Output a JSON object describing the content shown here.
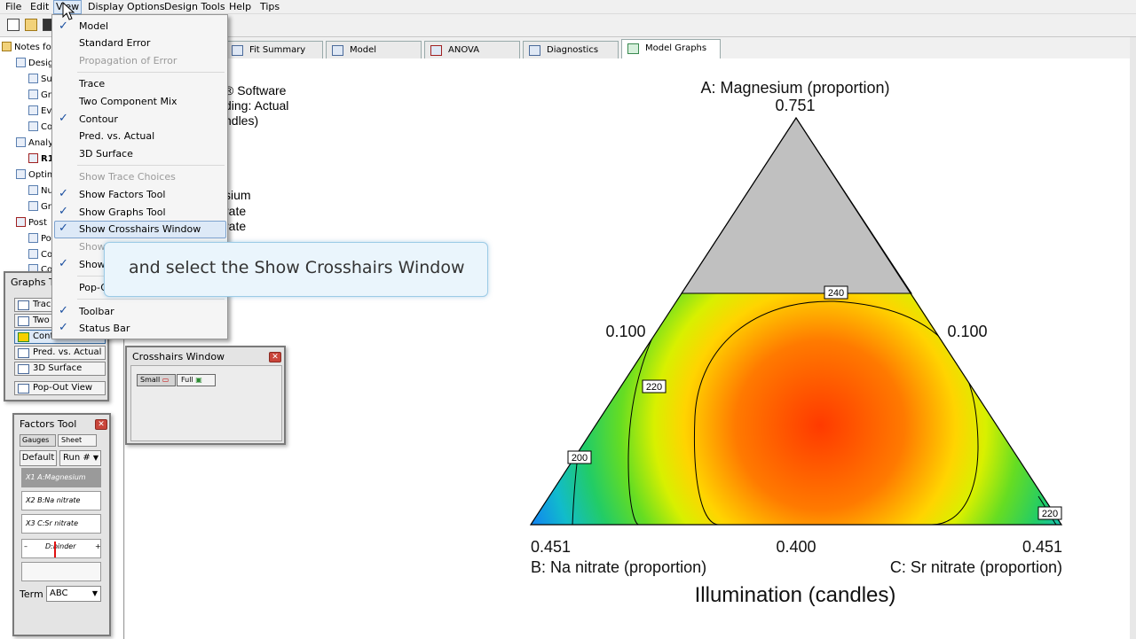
{
  "menubar": {
    "items": [
      "File",
      "Edit",
      "View",
      "Display Options",
      "Design Tools",
      "Help",
      "Tips"
    ]
  },
  "tree": {
    "items": [
      "Notes fo",
      "Desig",
      "Su",
      "Gr",
      "Ev",
      "Co",
      "Analy",
      "R1",
      "Optim",
      "Nu",
      "Gr",
      "Post",
      "Po",
      "Co",
      "Co"
    ]
  },
  "tabs": [
    "Fit Summary",
    "Model",
    "ANOVA",
    "Diagnostics",
    "Model Graphs"
  ],
  "content_text": [
    "® Software",
    "ding: Actual",
    "ndles)",
    "sium",
    "rate",
    "rate"
  ],
  "view_menu": {
    "items": [
      {
        "label": "Model",
        "checked": true,
        "disabled": false
      },
      {
        "label": "Standard Error",
        "checked": false,
        "disabled": false
      },
      {
        "label": "Propagation of Error",
        "checked": false,
        "disabled": true
      },
      {
        "label": "Trace",
        "checked": false,
        "disabled": false
      },
      {
        "label": "Two Component Mix",
        "checked": false,
        "disabled": false
      },
      {
        "label": "Contour",
        "checked": true,
        "disabled": false
      },
      {
        "label": "Pred. vs. Actual",
        "checked": false,
        "disabled": false
      },
      {
        "label": "3D Surface",
        "checked": false,
        "disabled": false
      },
      {
        "label": "Show Trace Choices",
        "checked": false,
        "disabled": true
      },
      {
        "label": "Show Factors Tool",
        "checked": true,
        "disabled": false
      },
      {
        "label": "Show Graphs Tool",
        "checked": true,
        "disabled": false
      },
      {
        "label": "Show Crosshairs Window",
        "checked": true,
        "disabled": false
      },
      {
        "label": "Show",
        "checked": false,
        "disabled": true
      },
      {
        "label": "Show",
        "checked": true,
        "disabled": false
      },
      {
        "label": "Pop-O",
        "checked": false,
        "disabled": false
      },
      {
        "label": "Toolbar",
        "checked": true,
        "disabled": false
      },
      {
        "label": "Status Bar",
        "checked": true,
        "disabled": false
      }
    ]
  },
  "callout": {
    "text": "and select the Show Crosshairs Window"
  },
  "graphs_tool": {
    "title": "Graphs To",
    "buttons": [
      "Trace",
      "Two C",
      "Conto",
      "Pred. vs. Actual",
      "3D Surface",
      "Pop-Out View"
    ]
  },
  "crosshairs": {
    "title": "Crosshairs Window",
    "small": "Small",
    "full": "Full"
  },
  "factors_tool": {
    "title": "Factors Tool",
    "gauges": "Gauges",
    "sheet": "Sheet",
    "default": "Default",
    "run": "Run #",
    "factors": [
      "X1 A:Magnesium",
      "X2 B:Na nitrate",
      "X3 C:Sr nitrate"
    ],
    "slider_label": "D:binder",
    "slider_minus": "–",
    "slider_plus": "+",
    "term_label": "Term",
    "term_value": "ABC"
  },
  "graph": {
    "top_vertex_label": "A: Magnesium (proportion)",
    "top_vertex_value": "0.751",
    "left_side_value": "0.100",
    "right_side_value": "0.100",
    "bottom_left_value": "0.451",
    "bottom_center_value": "0.400",
    "bottom_right_value": "0.451",
    "bottom_left_label": "B: Na nitrate (proportion)",
    "bottom_right_label": "C: Sr nitrate (proportion)",
    "response_title": "Illumination (candles)",
    "contour_labels": [
      "240",
      "220",
      "200",
      "220"
    ]
  },
  "colors": {
    "gray_region": "#c0c0c0",
    "hot": "#ff4000",
    "mid": "#ffdd00",
    "cool": "#33cc33",
    "cold": "#1199ee",
    "accent": "#3399ff"
  }
}
